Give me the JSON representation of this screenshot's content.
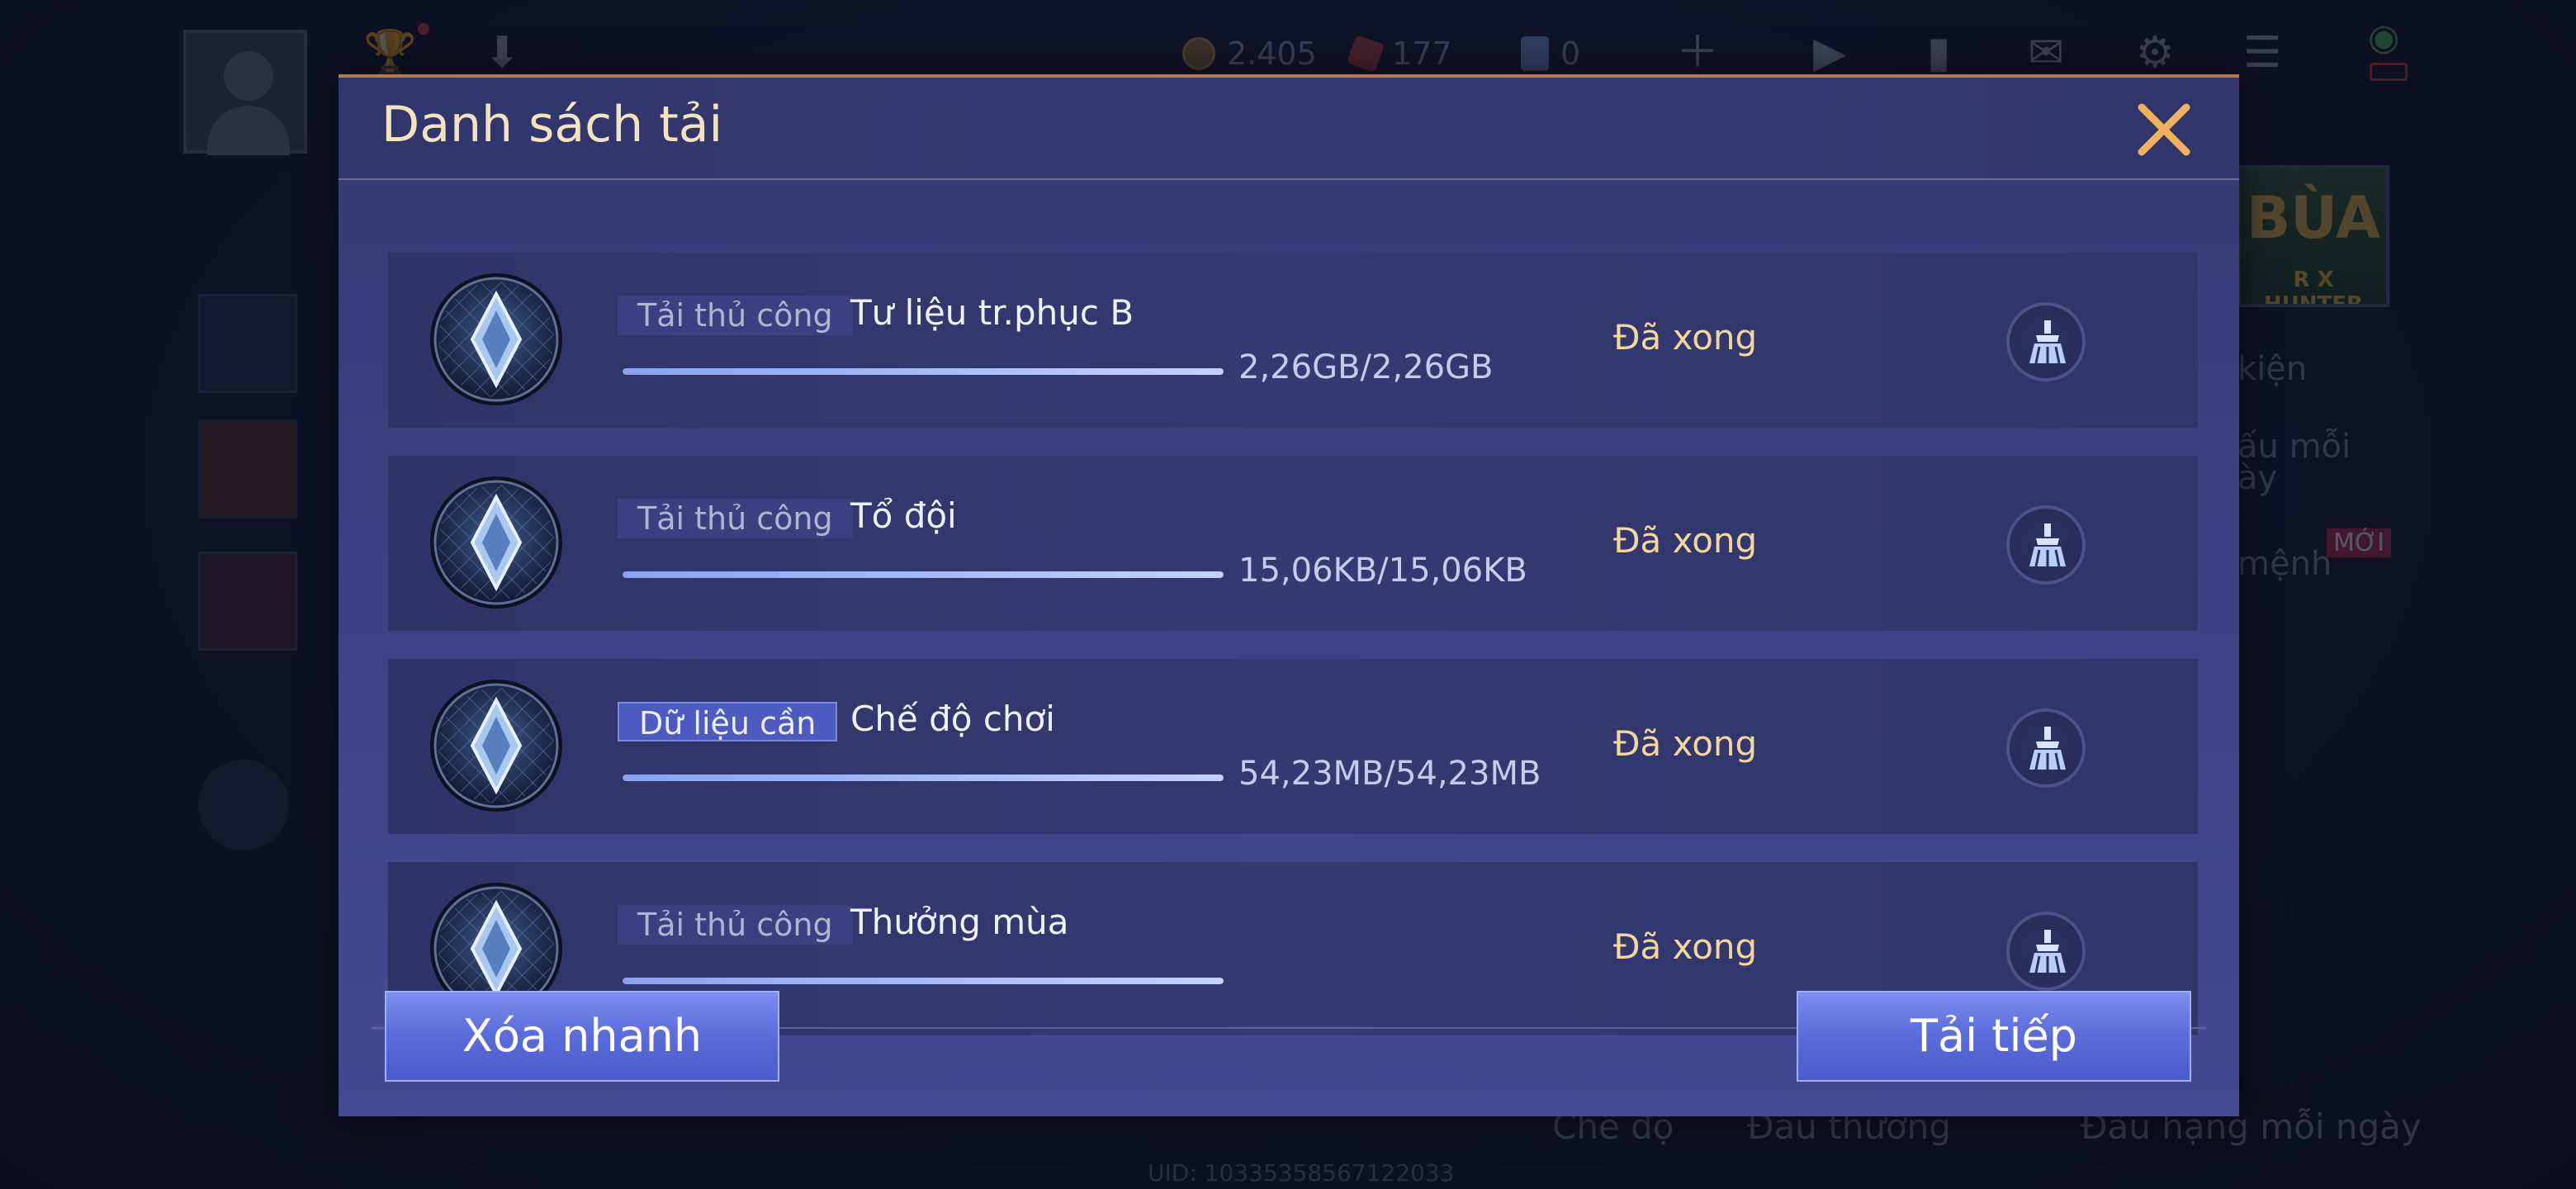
{
  "background": {
    "currency": [
      {
        "icon": "coin-icon",
        "value": "2.405"
      },
      {
        "icon": "gem-icon",
        "value": "177"
      },
      {
        "icon": "voucher-icon",
        "value": "0"
      }
    ],
    "right_banner": "BÙA",
    "right_banner_sub": "R X HUNTER",
    "right_items": [
      "kiện",
      "ấu mỗi",
      "ày",
      "mệnh"
    ],
    "new_badge": "MỚI",
    "bottom_items": [
      "Chế độ",
      "Đấu thường",
      "Đấu hạng mỗi ngày"
    ],
    "uid": "UID: 10335358567122033"
  },
  "dialog": {
    "title": "Danh sách tải",
    "close_icon": "close-icon",
    "items": [
      {
        "tag": "Tải thủ công",
        "tag_type": "manual",
        "name": "Tư liệu tr.phục B",
        "size": "2,26GB/2,26GB",
        "progress": 1.0,
        "status": "Đã xong"
      },
      {
        "tag": "Tải thủ công",
        "tag_type": "manual",
        "name": "Tổ đội",
        "size": "15,06KB/15,06KB",
        "progress": 1.0,
        "status": "Đã xong"
      },
      {
        "tag": "Dữ liệu cần",
        "tag_type": "required",
        "name": "Chế độ chơi",
        "size": "54,23MB/54,23MB",
        "progress": 1.0,
        "status": "Đã xong"
      },
      {
        "tag": "Tải thủ công",
        "tag_type": "manual",
        "name": "Thưởng mùa",
        "size": "",
        "progress": 1.0,
        "status": "Đã xong"
      }
    ],
    "quick_delete_label": "Xóa nhanh",
    "continue_label": "Tải tiếp"
  },
  "colors": {
    "title": "#f5e3bf",
    "status": "#f3d79a",
    "button": "#5b6edc",
    "close": "#f2b25a"
  }
}
